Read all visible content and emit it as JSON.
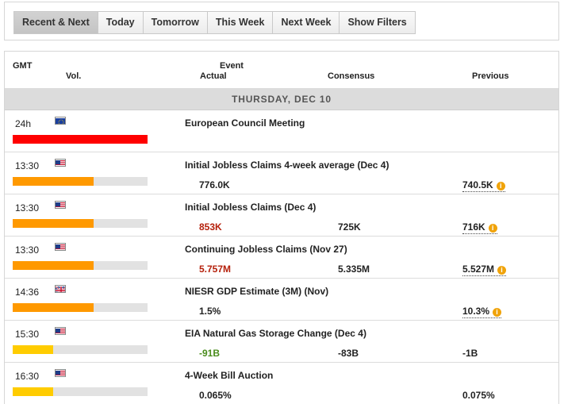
{
  "tabs": [
    {
      "label": "Recent & Next",
      "active": true
    },
    {
      "label": "Today",
      "active": false
    },
    {
      "label": "Tomorrow",
      "active": false
    },
    {
      "label": "This Week",
      "active": false
    },
    {
      "label": "Next Week",
      "active": false
    },
    {
      "label": "Show Filters",
      "active": false
    }
  ],
  "columns": {
    "gmt": "GMT",
    "vol": "Vol.",
    "event": "Event",
    "actual": "Actual",
    "consensus": "Consensus",
    "previous": "Previous"
  },
  "date_header": "THURSDAY, DEC 10",
  "colors": {
    "vol_high": "#ff0000",
    "vol_medium": "#ff9900",
    "vol_low": "#ffcc00",
    "actual_worse": "#b5200b",
    "actual_better": "#4a8c1c"
  },
  "events": [
    {
      "time": "24h",
      "flag": "eu-flag-icon",
      "name": "European Council Meeting",
      "volatility": 1.0,
      "vol_color": "#ff0000",
      "actual": "",
      "actual_status": "",
      "consensus": "",
      "previous": "",
      "previous_revised": false
    },
    {
      "time": "13:30",
      "flag": "us-flag-icon",
      "name": "Initial Jobless Claims 4-week average (Dec 4)",
      "volatility": 0.6,
      "vol_color": "#ff9900",
      "actual": "776.0K",
      "actual_status": "",
      "consensus": "",
      "previous": "740.5K",
      "previous_revised": true
    },
    {
      "time": "13:30",
      "flag": "us-flag-icon",
      "name": "Initial Jobless Claims (Dec 4)",
      "volatility": 0.6,
      "vol_color": "#ff9900",
      "actual": "853K",
      "actual_status": "neg",
      "consensus": "725K",
      "previous": "716K",
      "previous_revised": true
    },
    {
      "time": "13:30",
      "flag": "us-flag-icon",
      "name": "Continuing Jobless Claims (Nov 27)",
      "volatility": 0.6,
      "vol_color": "#ff9900",
      "actual": "5.757M",
      "actual_status": "neg",
      "consensus": "5.335M",
      "previous": "5.527M",
      "previous_revised": true
    },
    {
      "time": "14:36",
      "flag": "uk-flag-icon",
      "name": "NIESR GDP Estimate (3M) (Nov)",
      "volatility": 0.6,
      "vol_color": "#ff9900",
      "actual": "1.5%",
      "actual_status": "",
      "consensus": "",
      "previous": "10.3%",
      "previous_revised": true
    },
    {
      "time": "15:30",
      "flag": "us-flag-icon",
      "name": "EIA Natural Gas Storage Change (Dec 4)",
      "volatility": 0.3,
      "vol_color": "#ffcc00",
      "actual": "-91B",
      "actual_status": "pos",
      "consensus": "-83B",
      "previous": "-1B",
      "previous_revised": false
    },
    {
      "time": "16:30",
      "flag": "us-flag-icon",
      "name": "4-Week Bill Auction",
      "volatility": 0.3,
      "vol_color": "#ffcc00",
      "actual": "0.065%",
      "actual_status": "",
      "consensus": "",
      "previous": "0.075%",
      "previous_revised": false
    }
  ]
}
